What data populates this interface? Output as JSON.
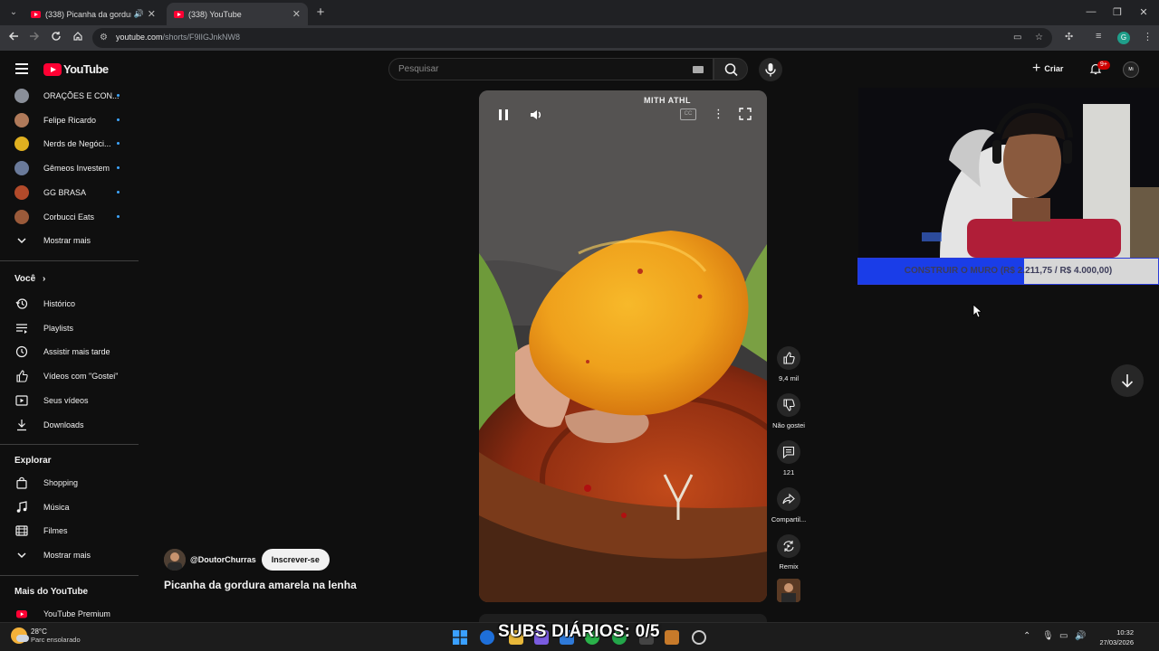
{
  "browser": {
    "tabs": [
      {
        "title": "(338) Picanha da gordura amarela na lenha - YouTube",
        "active": false,
        "audio": true
      },
      {
        "title": "(338) YouTube",
        "active": true,
        "audio": false
      }
    ],
    "url_host": "youtube.com",
    "url_path": "/shorts/F9lIGJnkNW8",
    "profile_letter": "G"
  },
  "masthead": {
    "logo_text": "YouTube",
    "search_placeholder": "Pesquisar",
    "create_label": "Criar",
    "notifications_badge": "9+",
    "avatar_text": "Mi"
  },
  "sidebar": {
    "subscriptions": [
      {
        "label": "ORAÇÕES E CON...",
        "color": "#8a8f99"
      },
      {
        "label": "Felipe Ricardo",
        "color": "#b07a5a"
      },
      {
        "label": "Nerds de Negóci...",
        "color": "#e0b020"
      },
      {
        "label": "Gêmeos Investem",
        "color": "#6a7a9a"
      },
      {
        "label": "GG BRASA",
        "color": "#b24a2a"
      },
      {
        "label": "Corbucci Eats",
        "color": "#9a5a3a"
      }
    ],
    "show_more_1": "Mostrar mais",
    "you_heading": "Você",
    "you_items": [
      {
        "label": "Histórico",
        "icon": "history-icon"
      },
      {
        "label": "Playlists",
        "icon": "playlists-icon"
      },
      {
        "label": "Assistir mais tarde",
        "icon": "clock-icon"
      },
      {
        "label": "Vídeos com \"Gostei\"",
        "icon": "like-icon"
      },
      {
        "label": "Seus vídeos",
        "icon": "video-icon"
      },
      {
        "label": "Downloads",
        "icon": "download-icon"
      }
    ],
    "explore_heading": "Explorar",
    "explore_items": [
      {
        "label": "Shopping",
        "icon": "shopping-bag-icon"
      },
      {
        "label": "Música",
        "icon": "music-icon"
      },
      {
        "label": "Filmes",
        "icon": "film-icon"
      }
    ],
    "show_more_2": "Mostrar mais",
    "more_heading": "Mais do YouTube",
    "more_items": [
      {
        "label": "YouTube Premium",
        "icon": "youtube-premium-icon"
      }
    ]
  },
  "short": {
    "video_overlay_text": "MITH ATHL",
    "actions": {
      "like_count": "9,4 mil",
      "dislike_label": "Não gostei",
      "comments_count": "121",
      "share_label": "Compartil...",
      "remix_label": "Remix"
    },
    "channel_handle": "@DoutorChurras",
    "subscribe_label": "Inscrever-se",
    "title": "Picanha da gordura amarela na lenha"
  },
  "stream_overlay": {
    "goal_text": "CONSTRUIR O MURO (R$ 2.211,75 / R$ 4.000,00)",
    "goal_progress": 0.553,
    "subs_text": "SUBS DIÁRIOS: 0/5"
  },
  "taskbar": {
    "temperature": "28°C",
    "weather_desc": "Parc ensolarado",
    "time": "10:32",
    "date": "27/03/2026"
  },
  "colors": {
    "brand_red": "#ff0033",
    "background": "#0f0f0f",
    "goal_fill": "#1a3de8",
    "link_blue": "#3ea6ff"
  }
}
